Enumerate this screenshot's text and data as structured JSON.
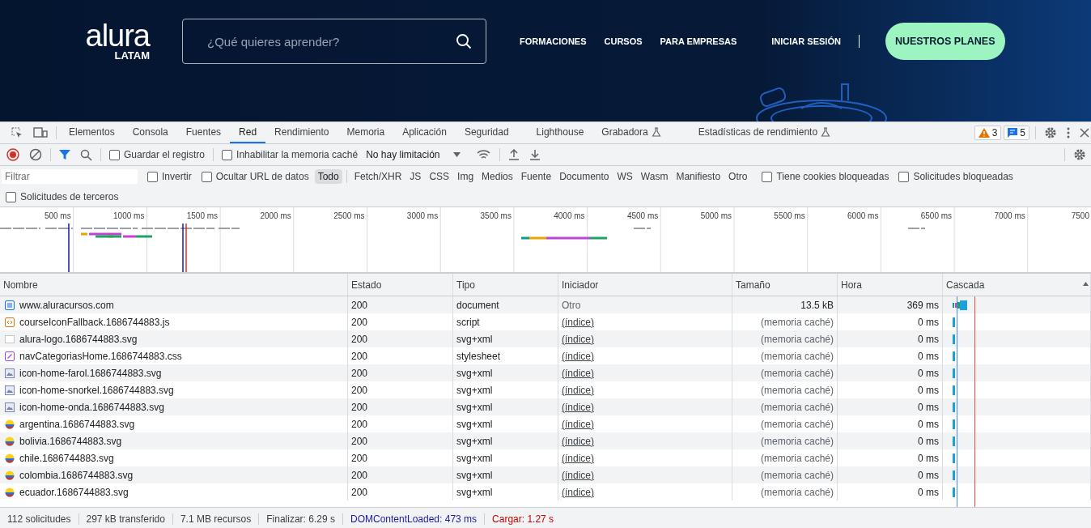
{
  "site": {
    "logo": {
      "wordmark": "alura",
      "region": "LATAM"
    },
    "search": {
      "placeholder": "¿Qué quieres aprender?"
    },
    "nav": [
      "FORMACIONES",
      "CURSOS",
      "PARA EMPRESAS"
    ],
    "login": "INICIAR SESIÓN",
    "cta": "NUESTROS PLANES"
  },
  "devtools": {
    "tabs": [
      {
        "label": "Elementos",
        "selected": false,
        "experimental": false
      },
      {
        "label": "Consola",
        "selected": false,
        "experimental": false
      },
      {
        "label": "Fuentes",
        "selected": false,
        "experimental": false
      },
      {
        "label": "Red",
        "selected": true,
        "experimental": false
      },
      {
        "label": "Rendimiento",
        "selected": false,
        "experimental": false
      },
      {
        "label": "Memoria",
        "selected": false,
        "experimental": false
      },
      {
        "label": "Aplicación",
        "selected": false,
        "experimental": false
      },
      {
        "label": "Seguridad",
        "selected": false,
        "experimental": false
      },
      {
        "label": "Lighthouse",
        "selected": false,
        "experimental": false
      },
      {
        "label": "Grabadora",
        "selected": false,
        "experimental": true
      },
      {
        "label": "Estadísticas de rendimiento",
        "selected": false,
        "experimental": true
      }
    ],
    "issues": [
      {
        "kind": "warning",
        "count": "3"
      },
      {
        "kind": "info",
        "count": "5"
      }
    ],
    "toolbar": {
      "recording": true,
      "filter_on": true,
      "preserve_log": {
        "label": "Guardar el registro",
        "checked": false
      },
      "disable_cache": {
        "label": "Inhabilitar la memoria caché",
        "checked": false
      },
      "throttling": "No hay limitación"
    },
    "filter": {
      "placeholder": "Filtrar",
      "options": [
        {
          "label": "Invertir",
          "checked": false
        },
        {
          "label": "Ocultar URL de datos",
          "checked": false
        }
      ],
      "types": [
        {
          "label": "Todo",
          "selected": true
        },
        {
          "label": "Fetch/XHR",
          "selected": false
        },
        {
          "label": "JS",
          "selected": false
        },
        {
          "label": "CSS",
          "selected": false
        },
        {
          "label": "Img",
          "selected": false
        },
        {
          "label": "Medios",
          "selected": false
        },
        {
          "label": "Fuente",
          "selected": false
        },
        {
          "label": "Documento",
          "selected": false
        },
        {
          "label": "WS",
          "selected": false
        },
        {
          "label": "Wasm",
          "selected": false
        },
        {
          "label": "Manifiesto",
          "selected": false
        },
        {
          "label": "Otro",
          "selected": false
        }
      ],
      "extra": [
        {
          "label": "Tiene cookies bloqueadas",
          "checked": false
        },
        {
          "label": "Solicitudes bloqueadas",
          "checked": false
        }
      ],
      "third_party": {
        "label": "Solicitudes de terceros",
        "checked": false
      }
    },
    "overview": {
      "ticks": [
        "500 ms",
        "1000 ms",
        "1500 ms",
        "2000 ms",
        "2500 ms",
        "3000 ms",
        "3500 ms",
        "4000 ms",
        "4500 ms",
        "5000 ms",
        "5500 ms",
        "6000 ms",
        "6500 ms",
        "7000 ms",
        "7500"
      ]
    },
    "table": {
      "columns": [
        "Nombre",
        "Estado",
        "Tipo",
        "Iniciador",
        "Tamaño",
        "Hora",
        "Cascada"
      ],
      "rows": [
        {
          "name": "www.aluracursos.com",
          "kind": "document",
          "status": "200",
          "resource_type": "document",
          "initiator": "Otro",
          "initiator_link": false,
          "size": "13.5 kB",
          "from_cache": false,
          "time": "369 ms"
        },
        {
          "name": "courseIconFallback.1686744883.js",
          "kind": "script",
          "status": "200",
          "resource_type": "script",
          "initiator": "(índice)",
          "initiator_link": true,
          "size": "(memoria caché)",
          "from_cache": true,
          "time": "0 ms"
        },
        {
          "name": "alura-logo.1686744883.svg",
          "kind": "blank",
          "status": "200",
          "resource_type": "svg+xml",
          "initiator": "(índice)",
          "initiator_link": true,
          "size": "(memoria caché)",
          "from_cache": true,
          "time": "0 ms"
        },
        {
          "name": "navCategoriasHome.1686744883.css",
          "kind": "stylesheet",
          "status": "200",
          "resource_type": "stylesheet",
          "initiator": "(índice)",
          "initiator_link": true,
          "size": "(memoria caché)",
          "from_cache": true,
          "time": "0 ms"
        },
        {
          "name": "icon-home-farol.1686744883.svg",
          "kind": "image",
          "status": "200",
          "resource_type": "svg+xml",
          "initiator": "(índice)",
          "initiator_link": true,
          "size": "(memoria caché)",
          "from_cache": true,
          "time": "0 ms"
        },
        {
          "name": "icon-home-snorkel.1686744883.svg",
          "kind": "image",
          "status": "200",
          "resource_type": "svg+xml",
          "initiator": "(índice)",
          "initiator_link": true,
          "size": "(memoria caché)",
          "from_cache": true,
          "time": "0 ms"
        },
        {
          "name": "icon-home-onda.1686744883.svg",
          "kind": "image",
          "status": "200",
          "resource_type": "svg+xml",
          "initiator": "(índice)",
          "initiator_link": true,
          "size": "(memoria caché)",
          "from_cache": true,
          "time": "0 ms"
        },
        {
          "name": "argentina.1686744883.svg",
          "kind": "flag",
          "status": "200",
          "resource_type": "svg+xml",
          "initiator": "(índice)",
          "initiator_link": true,
          "size": "(memoria caché)",
          "from_cache": true,
          "time": "0 ms"
        },
        {
          "name": "bolivia.1686744883.svg",
          "kind": "flag",
          "status": "200",
          "resource_type": "svg+xml",
          "initiator": "(índice)",
          "initiator_link": true,
          "size": "(memoria caché)",
          "from_cache": true,
          "time": "0 ms"
        },
        {
          "name": "chile.1686744883.svg",
          "kind": "flag",
          "status": "200",
          "resource_type": "svg+xml",
          "initiator": "(índice)",
          "initiator_link": true,
          "size": "(memoria caché)",
          "from_cache": true,
          "time": "0 ms"
        },
        {
          "name": "colombia.1686744883.svg",
          "kind": "flag",
          "status": "200",
          "resource_type": "svg+xml",
          "initiator": "(índice)",
          "initiator_link": true,
          "size": "(memoria caché)",
          "from_cache": true,
          "time": "0 ms"
        },
        {
          "name": "ecuador.1686744883.svg",
          "kind": "flag",
          "status": "200",
          "resource_type": "svg+xml",
          "initiator": "(índice)",
          "initiator_link": true,
          "size": "(memoria caché)",
          "from_cache": true,
          "time": "0 ms"
        }
      ]
    },
    "status_bar": [
      {
        "kind": "plain",
        "text": "112 solicitudes"
      },
      {
        "kind": "plain",
        "text": "297 kB transferido"
      },
      {
        "kind": "plain",
        "text": "7.1 MB recursos"
      },
      {
        "kind": "plain",
        "text": "Finalizar: 6.29 s"
      },
      {
        "kind": "dom",
        "text": "DOMContentLoaded: 473 ms"
      },
      {
        "kind": "load",
        "text": "Cargar: 1.27 s"
      }
    ]
  }
}
